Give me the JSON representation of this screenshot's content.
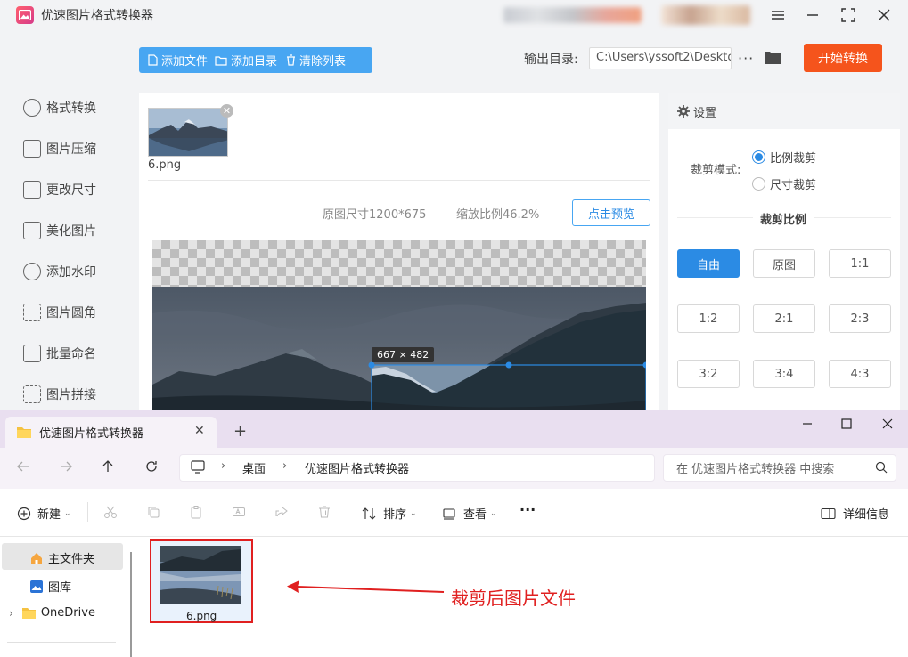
{
  "app": {
    "title": "优速图片格式转换器"
  },
  "nav": {
    "items": [
      {
        "label": "格式转换"
      },
      {
        "label": "图片压缩"
      },
      {
        "label": "更改尺寸"
      },
      {
        "label": "美化图片"
      },
      {
        "label": "添加水印"
      },
      {
        "label": "图片圆角"
      },
      {
        "label": "批量命名"
      },
      {
        "label": "图片拼接"
      }
    ]
  },
  "toolbar": {
    "add_file": "添加文件",
    "add_dir": "添加目录",
    "clear_list": "清除列表",
    "output_label": "输出目录:",
    "output_path": "C:\\Users\\yssoft2\\Deskto",
    "dots": "···",
    "start": "开始转换"
  },
  "work": {
    "file_name": "6.png",
    "orig_size": "原图尺寸1200*675",
    "scale": "缩放比例46.2%",
    "preview": "点击预览",
    "crop_dims": "667 × 482"
  },
  "settings": {
    "title": "设置",
    "crop_mode_label": "裁剪模式:",
    "crop_modes": [
      {
        "label": "比例裁剪",
        "selected": true
      },
      {
        "label": "尺寸裁剪",
        "selected": false
      }
    ],
    "ratio_title": "裁剪比例",
    "ratios": [
      "自由",
      "原图",
      "1:1",
      "1:2",
      "2:1",
      "2:3",
      "3:2",
      "3:4",
      "4:3"
    ],
    "active_ratio": "自由"
  },
  "explorer": {
    "tab_title": "优速图片格式转换器",
    "tab_close": "✕",
    "tab_new": "+",
    "breadcrumb": [
      "桌面",
      "优速图片格式转换器"
    ],
    "search_placeholder": "在 优速图片格式转换器 中搜索",
    "commands": {
      "new": "新建",
      "sort": "排序",
      "view": "查看",
      "more": "···",
      "details": "详细信息"
    },
    "sidebar": [
      {
        "label": "主文件夹"
      },
      {
        "label": "图库"
      },
      {
        "label": "OneDrive"
      }
    ],
    "file_name": "6.png",
    "annotation": "裁剪后图片文件"
  },
  "colors": {
    "accent": "#2b8be4",
    "toolbar_blue": "#48a6f2",
    "start_orange": "#f5541c",
    "annotation_red": "#e02020"
  }
}
